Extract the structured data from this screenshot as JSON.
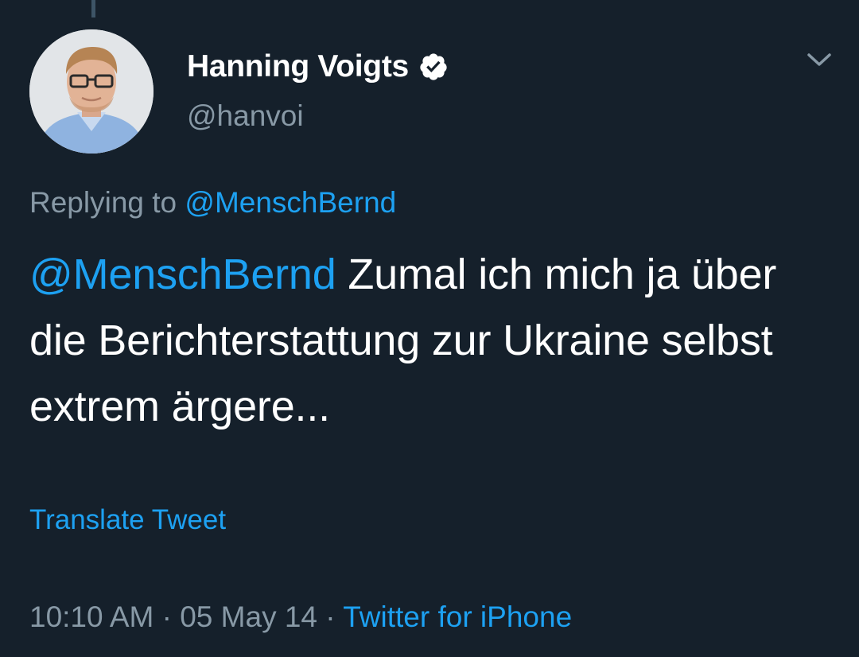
{
  "tweet": {
    "author": {
      "display_name": "Hanning Voigts",
      "handle": "@hanvoi",
      "verified": true
    },
    "reply": {
      "prefix": "Replying to ",
      "mention": "@MenschBernd"
    },
    "text": {
      "mention": "@MenschBernd",
      "body": " Zumal ich mich ja über die Berichterstattung zur Ukraine selbst extrem ärgere..."
    },
    "translate_label": "Translate Tweet",
    "meta": {
      "time": "10:10 AM",
      "separator": " · ",
      "date": "05 May 14",
      "source": "Twitter for iPhone"
    }
  },
  "icons": {
    "verified": "verified-badge-icon",
    "menu": "chevron-down-icon"
  },
  "colors": {
    "background": "#15202b",
    "primary_text": "#ffffff",
    "secondary_text": "#8899a6",
    "link": "#1da1f2"
  }
}
